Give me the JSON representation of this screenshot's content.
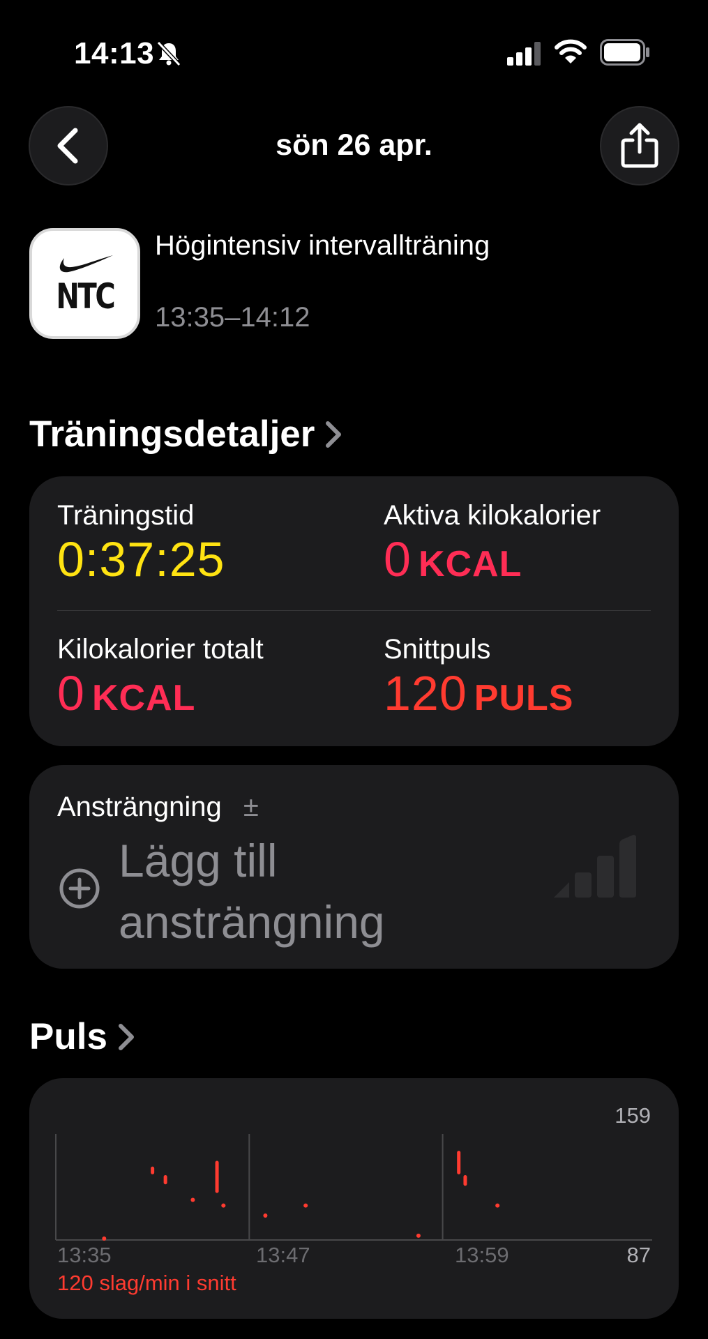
{
  "status_bar": {
    "time": "14:13",
    "icons": [
      "bell-slash-icon",
      "cellular-signal-icon",
      "wifi-icon",
      "battery-icon"
    ]
  },
  "nav": {
    "title": "sön 26 apr.",
    "back_icon": "chevron-left-icon",
    "share_icon": "share-icon"
  },
  "workout": {
    "app_icon_text": "NTC",
    "name": "Högintensiv intervallträning",
    "time_range": "13:35–14:12"
  },
  "details": {
    "section_title": "Träningsdetaljer",
    "metrics": [
      {
        "label": "Träningstid",
        "value": "0:37:25",
        "unit": "",
        "color": "#ffe312"
      },
      {
        "label": "Aktiva kilokalorier",
        "value": "0",
        "unit": "KCAL",
        "color": "#ff2d55"
      },
      {
        "label": "Kilokalorier totalt",
        "value": "0",
        "unit": "KCAL",
        "color": "#ff2d55"
      },
      {
        "label": "Snittpuls",
        "value": "120",
        "unit": "PULS",
        "color": "#ff3b30"
      }
    ]
  },
  "effort": {
    "label": "Ansträngning",
    "plus_minus": "±",
    "add_line1": "Lägg till",
    "add_line2": "ansträngning"
  },
  "heart_rate": {
    "section_title": "Puls",
    "avg_text": "120 slag/min i snitt",
    "accent_color": "#ff3b30"
  },
  "chart_data": {
    "type": "scatter",
    "x_tick_labels": [
      "13:35",
      "13:47",
      "13:59"
    ],
    "y_max_label": "159",
    "y_min_label": "87",
    "ylim": [
      87,
      159
    ],
    "xlim_minutes": [
      0,
      37
    ],
    "grid": "vertical",
    "series": [
      {
        "color": "#ff3b30",
        "points": [
          {
            "t": 3,
            "low": 88,
            "high": 88
          },
          {
            "t": 6,
            "low": 134,
            "high": 137
          },
          {
            "t": 6.8,
            "low": 127,
            "high": 131
          },
          {
            "t": 8.5,
            "low": 115,
            "high": 115
          },
          {
            "t": 10,
            "low": 121,
            "high": 141
          },
          {
            "t": 10.4,
            "low": 111,
            "high": 111
          },
          {
            "t": 13,
            "low": 104,
            "high": 104
          },
          {
            "t": 15.5,
            "low": 111,
            "high": 111
          },
          {
            "t": 22.5,
            "low": 90,
            "high": 90
          },
          {
            "t": 25,
            "low": 134,
            "high": 148
          },
          {
            "t": 25.4,
            "low": 126,
            "high": 131
          },
          {
            "t": 27.4,
            "low": 111,
            "high": 111
          }
        ]
      }
    ]
  }
}
